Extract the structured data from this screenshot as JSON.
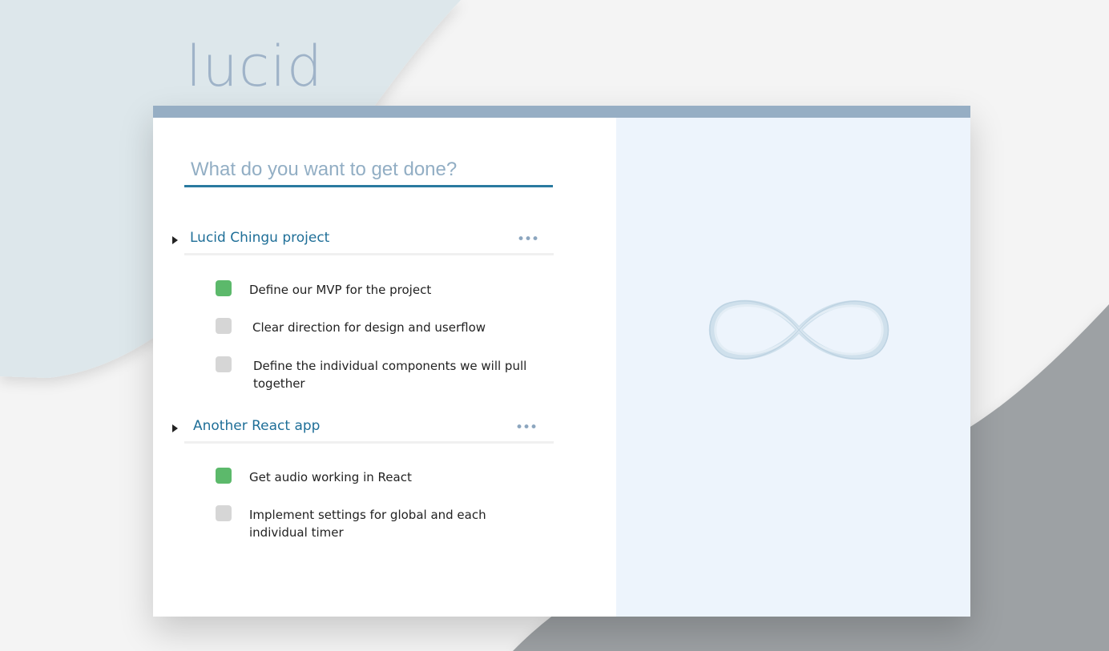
{
  "app": {
    "logo": "lucid"
  },
  "input": {
    "placeholder": "What do you want to get done?",
    "value": ""
  },
  "projects": [
    {
      "title": "Lucid Chingu project",
      "menu": "•••",
      "tasks": [
        {
          "text": "Define our MVP for the project",
          "done": true
        },
        {
          "text": "Clear direction for design and userflow",
          "done": false
        },
        {
          "text": "Define the individual components we will pull together",
          "done": false
        }
      ]
    },
    {
      "title": "Another React app",
      "menu": "•••",
      "tasks": [
        {
          "text": "Get audio working in React",
          "done": true
        },
        {
          "text": "Implement settings for global and each individual timer",
          "done": false
        }
      ]
    }
  ],
  "colors": {
    "accent": "#1f6f98",
    "bar": "#96aec4",
    "done": "#5cb96b",
    "pending": "#d6d6d6",
    "panel": "#edf4fc"
  },
  "icons": {
    "expand": "caret-right-icon",
    "more": "more-dots-icon",
    "illustration": "infinity-icon"
  }
}
